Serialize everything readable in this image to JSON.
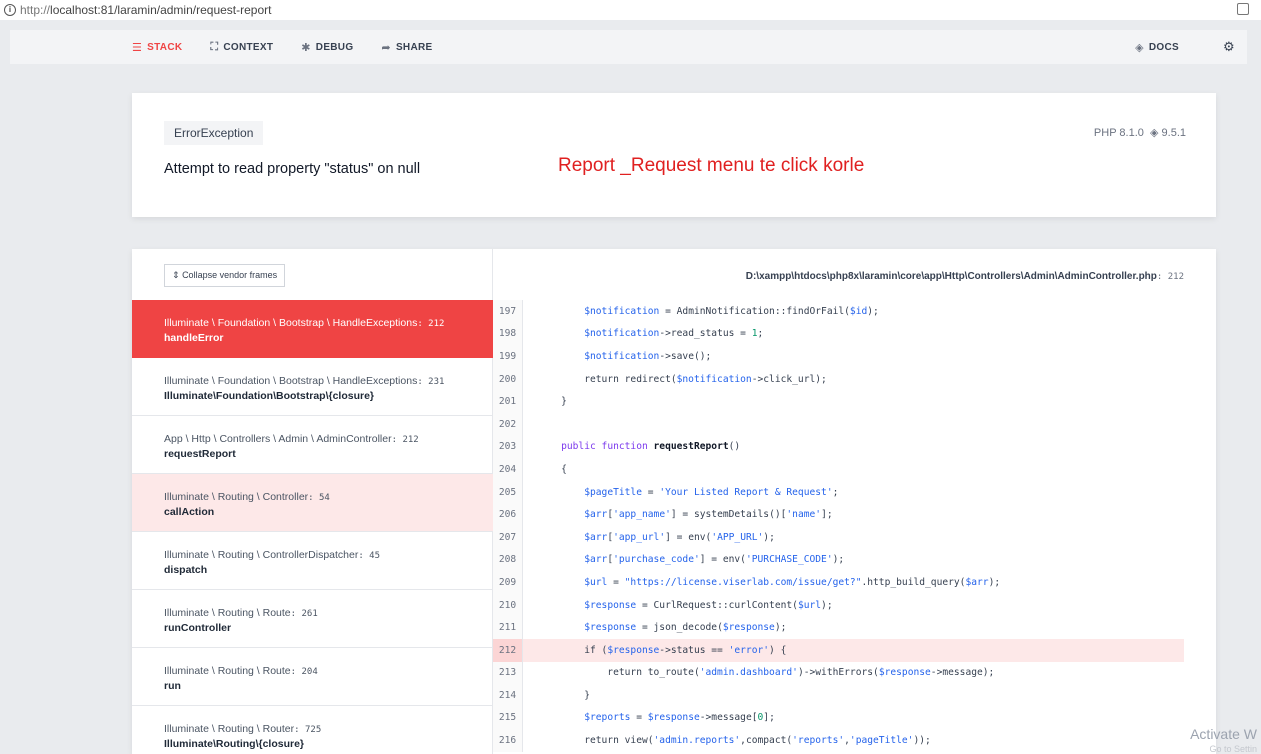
{
  "browser": {
    "url_scheme": "http://",
    "url_rest": "localhost:81/laramin/admin/request-report"
  },
  "nav": {
    "stack": "STACK",
    "context": "CONTEXT",
    "debug": "DEBUG",
    "share": "SHARE",
    "docs": "DOCS"
  },
  "error": {
    "type": "ErrorException",
    "message": "Attempt to read property \"status\" on null",
    "php_version": "PHP 8.1.0",
    "laravel_version": "9.5.1",
    "annotation": "Report _Request menu te click korle"
  },
  "stack": {
    "collapse_label": "Collapse vendor frames",
    "file_path": "D:\\xampp\\htdocs\\php8x\\laramin\\core\\app\\Http\\Controllers\\Admin\\AdminController.php",
    "file_line": ": 212",
    "frames": [
      {
        "cls": "Illuminate \\ Foundation \\ Bootstrap \\ HandleExceptions",
        "line": ": 212",
        "fn": "handleError"
      },
      {
        "cls": "Illuminate \\ Foundation \\ Bootstrap \\ HandleExceptions",
        "line": ": 231",
        "fn": "Illuminate\\Foundation\\Bootstrap\\{closure}"
      },
      {
        "cls": "App \\ Http \\ Controllers \\ Admin \\ AdminController",
        "line": ": 212",
        "fn": "requestReport"
      },
      {
        "cls": "Illuminate \\ Routing \\ Controller",
        "line": ": 54",
        "fn": "callAction"
      },
      {
        "cls": "Illuminate \\ Routing \\ ControllerDispatcher",
        "line": ": 45",
        "fn": "dispatch"
      },
      {
        "cls": "Illuminate \\ Routing \\ Route",
        "line": ": 261",
        "fn": "runController"
      },
      {
        "cls": "Illuminate \\ Routing \\ Route",
        "line": ": 204",
        "fn": "run"
      },
      {
        "cls": "Illuminate \\ Routing \\ Router",
        "line": ": 725",
        "fn": "Illuminate\\Routing\\{closure}"
      }
    ],
    "code_lines": [
      {
        "num": "197",
        "text": "        $notification = AdminNotification::findOrFail($id);"
      },
      {
        "num": "198",
        "text": "        $notification->read_status = 1;"
      },
      {
        "num": "199",
        "text": "        $notification->save();"
      },
      {
        "num": "200",
        "text": "        return redirect($notification->click_url);"
      },
      {
        "num": "201",
        "text": "    }"
      },
      {
        "num": "202",
        "text": ""
      },
      {
        "num": "203",
        "text": "    public function requestReport()"
      },
      {
        "num": "204",
        "text": "    {"
      },
      {
        "num": "205",
        "text": "        $pageTitle = 'Your Listed Report & Request';"
      },
      {
        "num": "206",
        "text": "        $arr['app_name'] = systemDetails()['name'];"
      },
      {
        "num": "207",
        "text": "        $arr['app_url'] = env('APP_URL');"
      },
      {
        "num": "208",
        "text": "        $arr['purchase_code'] = env('PURCHASE_CODE');"
      },
      {
        "num": "209",
        "text": "        $url = \"https://license.viserlab.com/issue/get?\".http_build_query($arr);"
      },
      {
        "num": "210",
        "text": "        $response = CurlRequest::curlContent($url);"
      },
      {
        "num": "211",
        "text": "        $response = json_decode($response);"
      },
      {
        "num": "212",
        "text": "        if ($response->status == 'error') {"
      },
      {
        "num": "213",
        "text": "            return to_route('admin.dashboard')->withErrors($response->message);"
      },
      {
        "num": "214",
        "text": "        }"
      },
      {
        "num": "215",
        "text": "        $reports = $response->message[0];"
      },
      {
        "num": "216",
        "text": "        return view('admin.reports',compact('reports','pageTitle'));"
      }
    ]
  },
  "watermark": {
    "title": "Activate W",
    "sub": "Go to Settin"
  }
}
